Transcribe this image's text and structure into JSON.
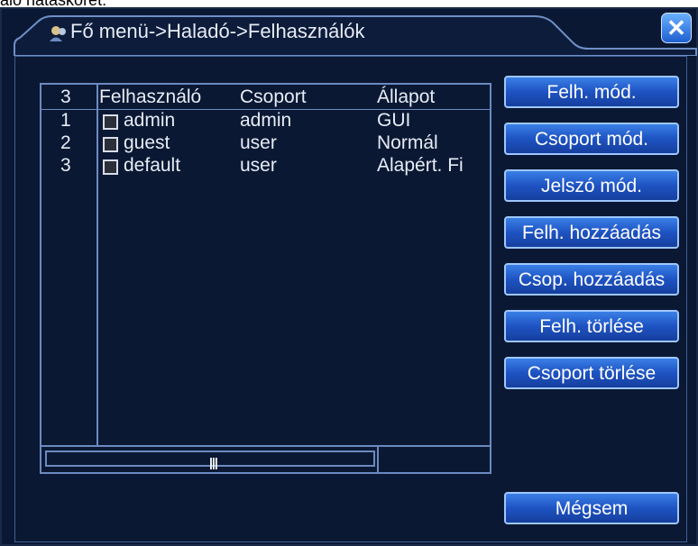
{
  "background_text": "alo hatáskörét.",
  "window": {
    "title": "Fő menü->Haladó->Felhasználók",
    "title_icon": "users-icon",
    "close_glyph": "✕"
  },
  "table": {
    "header": {
      "count": "3",
      "user": "Felhasználó",
      "group": "Csoport",
      "status": "Állapot"
    },
    "rows": [
      {
        "index": "1",
        "user": "admin",
        "group": "admin",
        "status": "GUI"
      },
      {
        "index": "2",
        "user": "guest",
        "group": "user",
        "status": "Normál"
      },
      {
        "index": "3",
        "user": "default",
        "group": "user",
        "status": "Alapért. Fi"
      }
    ],
    "scroll_grip": "|||"
  },
  "buttons": {
    "modify_user": "Felh. mód.",
    "modify_group": "Csoport mód.",
    "modify_password": "Jelszó mód.",
    "add_user": "Felh. hozzáadás",
    "add_group": "Csop. hozzáadás",
    "delete_user": "Felh. törlése",
    "delete_group": "Csoport törlése",
    "cancel": "Mégsem"
  },
  "colors": {
    "window_bg": "#0b1833",
    "accent": "#1e53c2",
    "border": "#6b8ac0"
  }
}
